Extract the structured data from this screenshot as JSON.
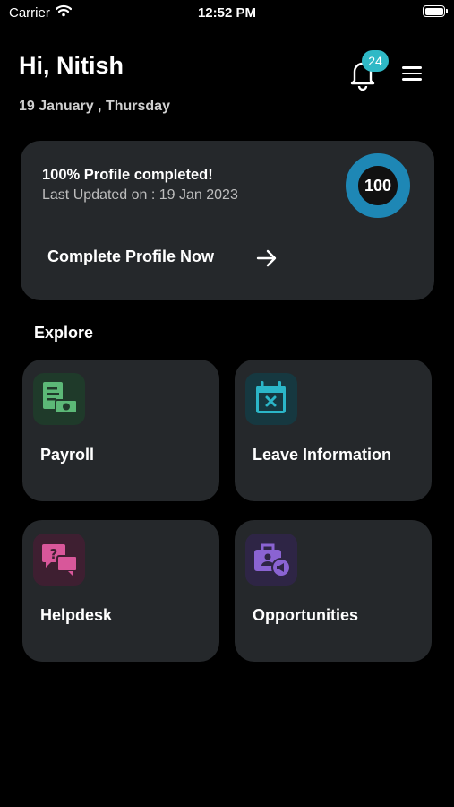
{
  "status_bar": {
    "carrier": "Carrier",
    "time": "12:52 PM"
  },
  "header": {
    "greeting": "Hi, Nitish",
    "date": "19 January , Thursday",
    "notification_count": "24"
  },
  "profile": {
    "title": "100%  Profile completed!",
    "last_updated": "Last Updated on  : 19 Jan 2023",
    "progress": "100",
    "progress_fraction": 1.0,
    "cta_label": "Complete Profile Now"
  },
  "explore": {
    "title": "Explore",
    "tiles": [
      {
        "label": "Payroll",
        "icon": "payroll-icon",
        "color": "#5cb877"
      },
      {
        "label": "Leave Information",
        "icon": "calendar-x-icon",
        "color": "#2bb6c8"
      },
      {
        "label": "Helpdesk",
        "icon": "chat-question-icon",
        "color": "#d8579a"
      },
      {
        "label": "Opportunities",
        "icon": "briefcase-megaphone-icon",
        "color": "#8a63d2"
      }
    ]
  },
  "colors": {
    "background": "#000000",
    "card": "#25282b",
    "accent": "#2fb9c6",
    "ring": "#1e87b5"
  }
}
